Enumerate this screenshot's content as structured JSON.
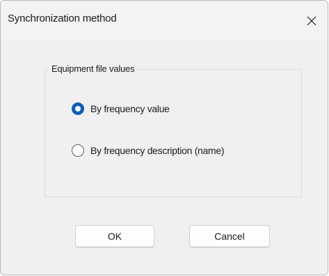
{
  "window": {
    "title": "Synchronization method",
    "close_icon": "close-icon"
  },
  "group": {
    "legend": "Equipment file values",
    "options": [
      {
        "label": "By frequency value",
        "selected": true
      },
      {
        "label": "By frequency description (name)",
        "selected": false
      }
    ]
  },
  "buttons": {
    "ok_label": "OK",
    "cancel_label": "Cancel"
  },
  "colors": {
    "accent": "#0a5fb4",
    "background": "#f0f0f0"
  }
}
